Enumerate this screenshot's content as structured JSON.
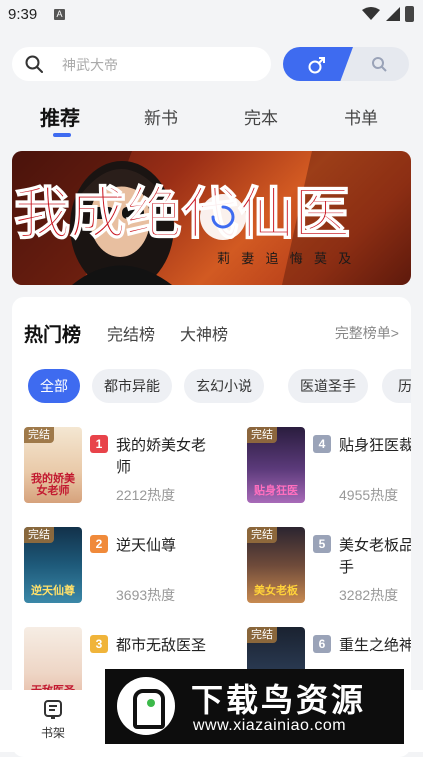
{
  "status_bar": {
    "time": "9:39",
    "notif_icon": "A"
  },
  "search": {
    "placeholder": "神武大帝"
  },
  "gender": {
    "selected": "male"
  },
  "tabs": [
    {
      "label": "推荐",
      "active": true
    },
    {
      "label": "新书",
      "active": false
    },
    {
      "label": "完本",
      "active": false
    },
    {
      "label": "书单",
      "active": false
    }
  ],
  "banner": {
    "headline": "我成绝代仙医",
    "subline": "莉 妻 追 悔 莫 及"
  },
  "ranking": {
    "tabs": [
      {
        "label": "热门榜",
        "active": true
      },
      {
        "label": "完结榜",
        "active": false
      },
      {
        "label": "大神榜",
        "active": false
      }
    ],
    "full_link": "完整榜单>",
    "chips": [
      {
        "label": "全部",
        "active": true
      },
      {
        "label": "都市异能",
        "active": false
      },
      {
        "label": "玄幻小说",
        "active": false
      },
      {
        "label": "医道圣手",
        "active": false
      },
      {
        "label": "历史",
        "active": false
      }
    ],
    "books": [
      {
        "rank": "1",
        "title": "我的娇美女老师",
        "heat": "2212热度",
        "tag": "完结",
        "cover_text": "我的娇美女老师",
        "rank_color": "#e8434a"
      },
      {
        "rank": "4",
        "title": "贴身狂医裁",
        "heat": "4955热度",
        "tag": "完结",
        "cover_text": "贴身狂医",
        "rank_color": "#9aa3b8"
      },
      {
        "rank": "2",
        "title": "逆天仙尊",
        "heat": "3693热度",
        "tag": "完结",
        "cover_text": "逆天仙尊",
        "rank_color": "#f08a3a"
      },
      {
        "rank": "5",
        "title": "美女老板品高手",
        "heat": "3282热度",
        "tag": "完结",
        "cover_text": "美女老板",
        "rank_color": "#9aa3b8"
      },
      {
        "rank": "3",
        "title": "都市无敌医圣",
        "heat": "",
        "tag": "",
        "cover_text": "无敌医圣",
        "rank_color": "#f0b43a"
      },
      {
        "rank": "6",
        "title": "重生之绝神",
        "heat": "",
        "tag": "完结",
        "cover_text": "",
        "rank_color": "#9aa3b8"
      }
    ]
  },
  "bottom_nav": {
    "bookshelf": "书架"
  },
  "watermark": {
    "title": "下载鸟资源",
    "url": "www.xiazainiao.com"
  },
  "colors": {
    "accent": "#3e6bf0",
    "background": "#f3f4f6"
  }
}
